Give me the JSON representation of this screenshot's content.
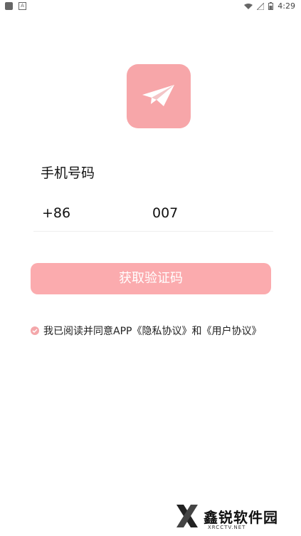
{
  "status_bar": {
    "time": "4:29"
  },
  "screen": {
    "title": "手机号码",
    "phone": {
      "country_code": "+86",
      "number": "007"
    },
    "get_code_button": "获取验证码",
    "agreement": {
      "text": "我已阅读并同意APP《隐私协议》和《用户协议》",
      "checked": true
    }
  },
  "watermark": {
    "title": "鑫锐软件园",
    "subtitle": "XRCCTV.NET"
  },
  "colors": {
    "accent": "#f7a6a9",
    "button": "#fbabae",
    "text": "#111111"
  },
  "icons": [
    "paper-plane-icon",
    "wifi-icon",
    "signal-icon",
    "battery-icon",
    "check-icon"
  ]
}
